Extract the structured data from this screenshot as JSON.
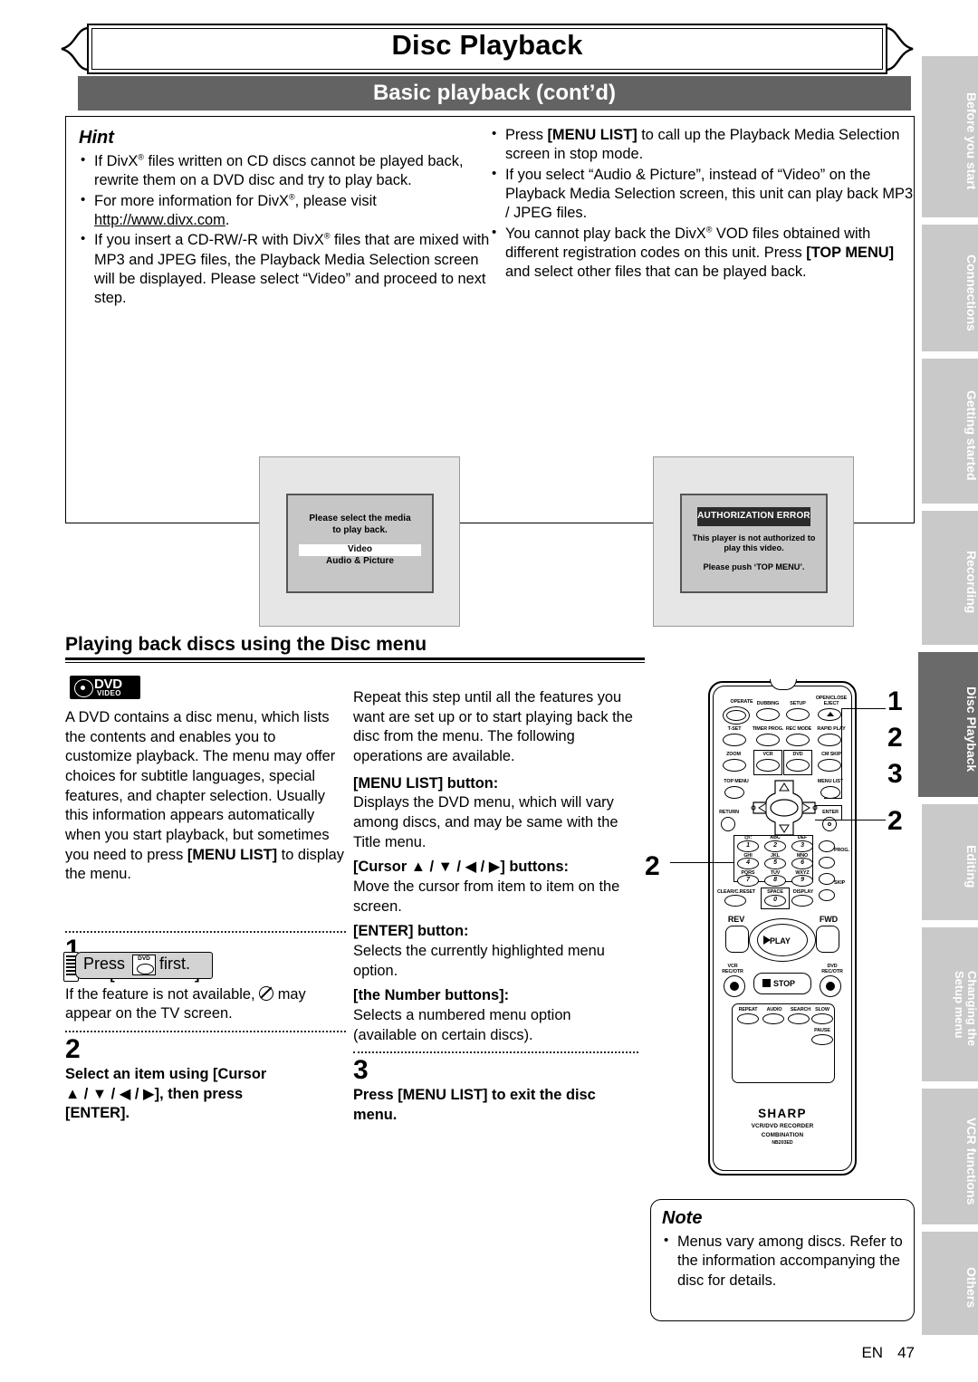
{
  "banner": {
    "title": "Disc Playback"
  },
  "section_bar": {
    "label": "Basic playback (cont’d)"
  },
  "hint": {
    "label": "Hint",
    "left_items": [
      "If DivX® files written on CD discs cannot be played back, rewrite them on a DVD disc and try to play back.",
      "For more information for DivX®, please visit http://www.divx.com.",
      "If you insert a CD-RW/-R with DivX® files that are mixed with MP3 and JPEG files, the Playback Media Selection screen will be displayed. Please select “Video” and proceed to next step."
    ],
    "right_items": [
      "Press [MENU LIST] to call up the Playback Media Selection screen in stop mode.",
      "If you select “Audio & Picture”, instead of “Video” on the Playback Media Selection screen, this unit can play back MP3 / JPEG files.",
      "You cannot play back the DivX® VOD files obtained with different registration codes on this unit. Press [TOP MENU] and select other files that can be played back."
    ],
    "link_text": "http://www.divx.com"
  },
  "tv_screen_1": {
    "line1": "Please select the media",
    "line2": "to play back.",
    "option_highlighted": "Video",
    "option_second": "Audio & Picture"
  },
  "tv_screen_2": {
    "error_title": "AUTHORIZATION ERROR",
    "line1": "This player is not authorized to",
    "line2": "play this video.",
    "line3": "Please push ‘TOP MENU’."
  },
  "section": {
    "heading": "Playing back discs using the Disc menu"
  },
  "dvd_logo": {
    "top": "DVD",
    "bottom": "VIDEO"
  },
  "col1": {
    "intro": "A DVD contains a disc menu, which lists the contents and enables you to customize playback. The menu may offer choices for subtitle languages, special features, and chapter selection. Usually this information appears automatically when you start playback, but sometimes you need to press [MENU LIST] to display the menu.",
    "press_first_pre": "Press",
    "press_first_post": "first.",
    "press_first_button": "DVD",
    "step1_num": "1",
    "step1_head": "Press [MENU LIST].",
    "step1_body_a": "If the feature is not available,",
    "step1_body_b": "may appear on the TV screen.",
    "step2_num": "2",
    "step2_head_a": "Select an item using [Cursor",
    "step2_head_b": "▲ / ▼ / ◀ / ▶], then press",
    "step2_head_c": "[ENTER]."
  },
  "col2": {
    "repeat": "Repeat this step until all the features you want are set up or to start playing back the disc from the menu. The following operations are available.",
    "ops": [
      {
        "title": "[MENU LIST] button:",
        "body": "Displays the DVD menu, which will vary among discs, and may be same with the Title menu."
      },
      {
        "title": "[Cursor ▲ / ▼ / ◀ / ▶] buttons:",
        "body": "Move the cursor from item to item on the screen."
      },
      {
        "title": "[ENTER] button:",
        "body": "Selects the currently highlighted menu option."
      },
      {
        "title": "[the Number buttons]:",
        "body": "Selects a numbered menu option (available on certain discs)."
      }
    ],
    "step3_num": "3",
    "step3_head": "Press [MENU LIST] to exit the disc menu."
  },
  "note": {
    "label": "Note",
    "items": [
      "Menus vary among discs. Refer to the information accompanying the disc for details."
    ]
  },
  "callouts": {
    "c1": "1",
    "c2": "2",
    "c3": "3",
    "c4": "2",
    "c5": "2"
  },
  "remote": {
    "brand": "SHARP",
    "model_line1": "VCR/DVD RECORDER",
    "model_line2": "COMBINATION",
    "model_line3": "NB203ED",
    "labels": {
      "operate": "OPERATE",
      "dubbing": "DUBBING",
      "setup": "SETUP",
      "open_close": "OPEN/CLOSE",
      "eject": "EJECT",
      "tset": "T-SET",
      "timer_prog": "TIMER PROG.",
      "rec_mode": "REC MODE",
      "rapid_play": "RAPID PLAY",
      "zoom": "ZOOM",
      "vcr": "VCR",
      "dvd": "DVD",
      "cm_skip": "CM SKIP",
      "top_menu": "TOP MENU",
      "menu_list": "MENU LIST",
      "return": "RETURN",
      "enter": "ENTER",
      "prog": "PROG.",
      "skip": "SKIP",
      "clear": "CLEAR/C.RESET",
      "space": "SPACE",
      "display": "DISPLAY",
      "rev": "REV",
      "fwd": "FWD",
      "play": "PLAY",
      "stop": "STOP",
      "vcr_rec": "VCR",
      "vcr_rec2": "REC/OTR",
      "dvd_rec": "DVD",
      "dvd_rec2": "REC/OTR",
      "repeat": "REPEAT",
      "audio": "AUDIO",
      "search": "SEARCH",
      "slow": "SLOW",
      "pause": "PAUSE"
    },
    "numbers": [
      "1",
      "2",
      "3",
      "4",
      "5",
      "6",
      "7",
      "8",
      "9",
      "0"
    ],
    "number_letters": [
      "@/:",
      "ABC",
      "DEF",
      "GHI",
      "JKL",
      "MNO",
      "PQRS",
      "TUV",
      "WXYZ"
    ]
  },
  "sidebar": {
    "tabs": [
      {
        "label": "Before you start",
        "active": false
      },
      {
        "label": "Connections",
        "active": false
      },
      {
        "label": "Getting started",
        "active": false
      },
      {
        "label": "Recording",
        "active": false
      },
      {
        "label": "Disc Playback",
        "active": true
      },
      {
        "label": "Editing",
        "active": false
      },
      {
        "label": "Changing the\nSetup menu",
        "active": false
      },
      {
        "label": "VCR functions",
        "active": false
      },
      {
        "label": "Others",
        "active": false
      }
    ]
  },
  "footer": {
    "lang": "EN",
    "page": "47"
  }
}
